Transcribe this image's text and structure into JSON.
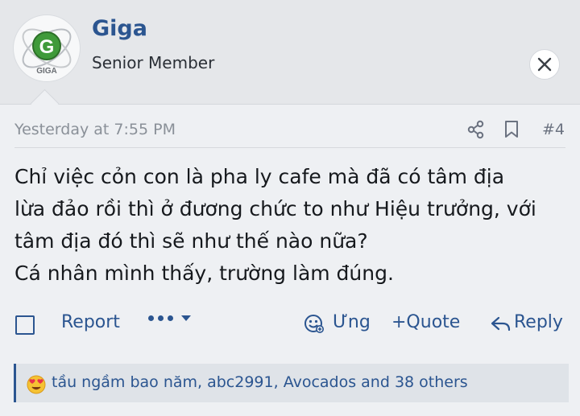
{
  "user": {
    "name": "Giga",
    "title": "Senior Member",
    "avatar_text": "GIGA",
    "avatar_letter": "G"
  },
  "post": {
    "date": "Yesterday at 7:55 PM",
    "number": "#4",
    "lines": [
      "Chỉ việc cỏn con là pha ly cafe mà đã có tâm địa",
      "lừa đảo rồi thì ở đương chức to như Hiệu trưởng, với",
      "tâm địa đó thì sẽ như thế nào nữa?",
      "Cá nhân mình thấy, trường làm đúng."
    ]
  },
  "actions": {
    "report": "Report",
    "react": "Ưng",
    "quote": "+Quote",
    "reply": "Reply"
  },
  "reactions": {
    "text": "tầu ngầm bao năm, abc2991, Avocados and 38 others"
  },
  "colors": {
    "link": "#2b5590",
    "header_bg": "#e5e7ea",
    "body_bg": "#eef0f3",
    "reaction_bar_bg": "#dfe3e8"
  }
}
